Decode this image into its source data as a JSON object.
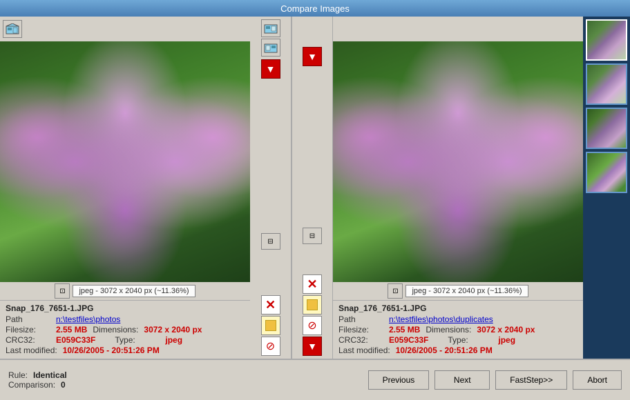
{
  "window": {
    "title": "Compare Images"
  },
  "left_image": {
    "filename": "Snap_176_7651-1.JPG",
    "path_label": "Path",
    "path_value": "n:\\testfiles\\photos",
    "filesize_label": "Filesize:",
    "filesize_value": "2.55 MB",
    "dimensions_label": "Dimensions:",
    "dimensions_value": "3072 x 2040 px",
    "crc32_label": "CRC32:",
    "crc32_value": "E059C33F",
    "type_label": "Type:",
    "type_value": "jpeg",
    "modified_label": "Last modified:",
    "modified_value": "10/26/2005 - 20:51:26 PM",
    "img_label": "jpeg - 3072 x 2040 px (~11.36%)"
  },
  "right_image": {
    "filename": "Snap_176_7651-1.JPG",
    "path_label": "Path",
    "path_value": "n:\\testfiles\\photos\\duplicates",
    "filesize_label": "Filesize:",
    "filesize_value": "2.55 MB",
    "dimensions_label": "Dimensions:",
    "dimensions_value": "3072 x 2040 px",
    "crc32_label": "CRC32:",
    "crc32_value": "E059C33F",
    "type_label": "Type:",
    "type_value": "jpeg",
    "modified_label": "Last modified:",
    "modified_value": "10/26/2005 - 20:51:26 PM",
    "img_label": "jpeg - 3072 x 2040 px (~11.36%)"
  },
  "footer": {
    "rule_label": "Rule:",
    "rule_value": "Identical",
    "comparison_label": "Comparison:",
    "comparison_value": "0"
  },
  "buttons": {
    "previous": "Previous",
    "next": "Next",
    "faststep": "FastStep>>",
    "abort": "Abort"
  },
  "sidebar": {
    "thumbnails": 4
  }
}
